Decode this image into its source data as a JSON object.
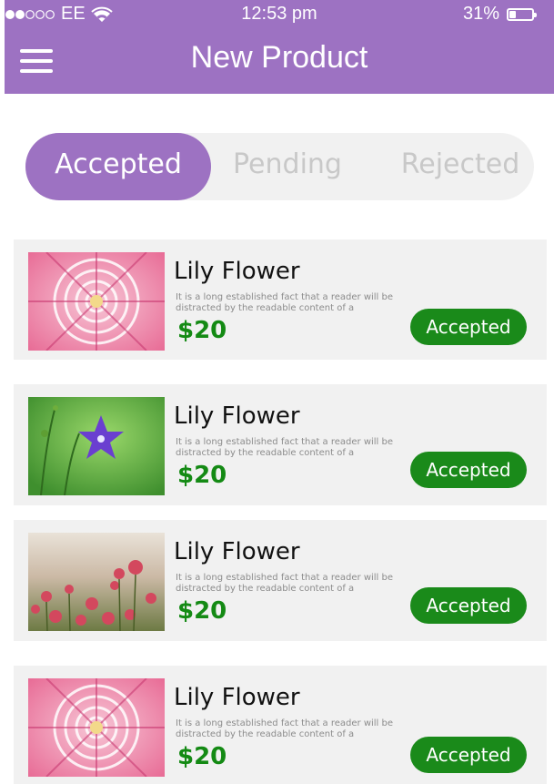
{
  "status_bar": {
    "carrier": "EE",
    "time": "12:53 pm",
    "battery": "31%",
    "battery_level": 0.31
  },
  "header": {
    "title": "New Product",
    "menu_icon": "hamburger-menu-icon",
    "background": "#9d72c2"
  },
  "tabs": [
    {
      "label": "Accepted",
      "active": true
    },
    {
      "label": "Pending",
      "active": false
    },
    {
      "label": "Rejected",
      "active": false
    }
  ],
  "products": [
    {
      "title": "Lily Flower",
      "description": "It is a long established fact that a reader will be distracted by the readable content of a",
      "price": "$20",
      "status": "Accepted",
      "image": "pink-dahlia-image"
    },
    {
      "title": "Lily Flower",
      "description": "It is a long established fact that a reader will be distracted by the readable content of a",
      "price": "$20",
      "status": "Accepted",
      "image": "purple-bellflower-image"
    },
    {
      "title": "Lily Flower",
      "description": "It is a long established fact that a reader will be distracted by the readable content of a",
      "price": "$20",
      "status": "Accepted",
      "image": "dahlia-field-image"
    },
    {
      "title": "Lily Flower",
      "description": "It is a long established fact that a reader will be distracted by the readable content of a",
      "price": "$20",
      "status": "Accepted",
      "image": "pink-dahlia-image"
    }
  ],
  "colors": {
    "accent": "#9d72c2",
    "price": "#148a14",
    "status_button": "#1a8a1a",
    "card_background": "#f1f1f1"
  }
}
